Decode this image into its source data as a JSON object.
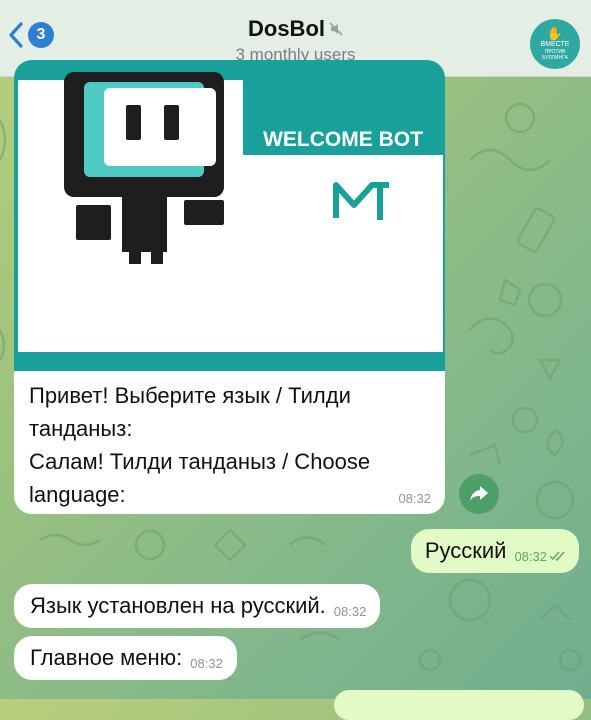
{
  "header": {
    "back_badge": "3",
    "title": "DosBol",
    "subtitle": "3 monthly users",
    "avatar": {
      "line1": "ВМЕСТЕ",
      "line2": "ПРОТИВ",
      "line3": "БУЛЛИНГА"
    }
  },
  "welcome_card": {
    "banner_text": "WELCOME BOT",
    "banner_logo": "MT",
    "lines": [
      "Привет! Выберите язык / Тилди",
      "танданыз:",
      "Салам! Тилди танданыз / Choose",
      "language:"
    ],
    "time": "08:32"
  },
  "outgoing": {
    "text": "Русский",
    "time": "08:32"
  },
  "incoming": [
    {
      "text": "Язык установлен на русский.",
      "time": "08:32"
    },
    {
      "text": "Главное меню:",
      "time": "08:32"
    }
  ],
  "colors": {
    "accent": "#2f7fd0",
    "banner_teal": "#1aa09b",
    "outgoing_bubble": "#e2fbc6"
  },
  "icons": [
    "back-chevron-icon",
    "mute-icon",
    "forward-icon",
    "double-check-icon"
  ]
}
